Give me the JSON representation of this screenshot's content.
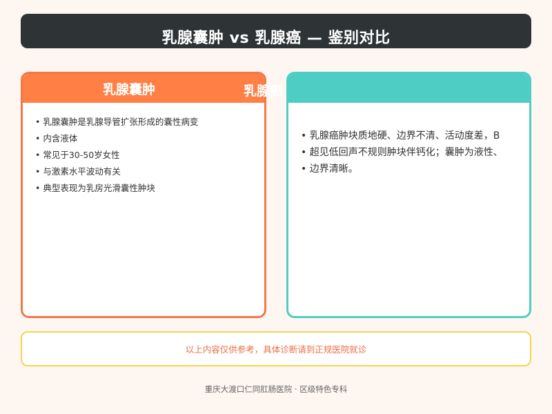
{
  "header": {
    "title": "乳腺囊肿 vs 乳腺癌 — 鉴别对比"
  },
  "left_card": {
    "title": "乳腺囊肿",
    "overflow_title": "乳腺癌",
    "items": [
      "乳腺囊肿是乳腺导管扩张形成的囊性病变",
      "内含液体",
      "常见于30-50岁女性",
      "与激素水平波动有关",
      "典型表现为乳房光滑囊性肿块"
    ]
  },
  "right_card": {
    "title": "",
    "items": [
      "乳腺癌肿块质地硬、边界不清、活动度差，B",
      "超见低回声不规则肿块伴钙化；囊肿为液性、",
      "边界清晰。"
    ]
  },
  "notice": {
    "text": "以上内容仅供参考，具体诊断请到正规医院就诊"
  },
  "footer": {
    "text": "重庆大渡口仁同肛肠医院 · 区级特色专科"
  },
  "colors": {
    "title_bg": "#2e3436",
    "left_accent": "#ff7f45",
    "right_accent": "#4ecdc4",
    "notice_border": "#f7d44c",
    "notice_text": "#e8704a"
  }
}
